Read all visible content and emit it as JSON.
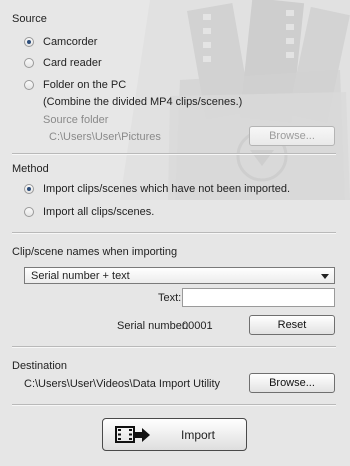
{
  "source": {
    "title": "Source",
    "options": [
      "Camcorder",
      "Card reader",
      "Folder on the PC"
    ],
    "selected": "Camcorder",
    "folder_note": "(Combine the divided MP4 clips/scenes.)",
    "folder_label": "Source folder",
    "folder_path": "C:\\Users\\User\\Pictures",
    "browse_label": "Browse..."
  },
  "method": {
    "title": "Method",
    "options": [
      "Import clips/scenes which have not been imported.",
      "Import all clips/scenes."
    ],
    "selected": "Import clips/scenes which have not been imported."
  },
  "naming": {
    "title": "Clip/scene names when importing",
    "selected_option": "Serial number + text",
    "text_label": "Text:",
    "text_value": "",
    "serial_label": "Serial number:",
    "serial_value": "00001",
    "reset_label": "Reset"
  },
  "destination": {
    "title": "Destination",
    "path": "C:\\Users\\User\\Videos\\Data Import Utility",
    "browse_label": "Browse..."
  },
  "import_label": "Import",
  "icons": [
    "radio-icon",
    "dropdown-arrow-icon",
    "film-import-icon",
    "folder-film-watermark-icon"
  ]
}
